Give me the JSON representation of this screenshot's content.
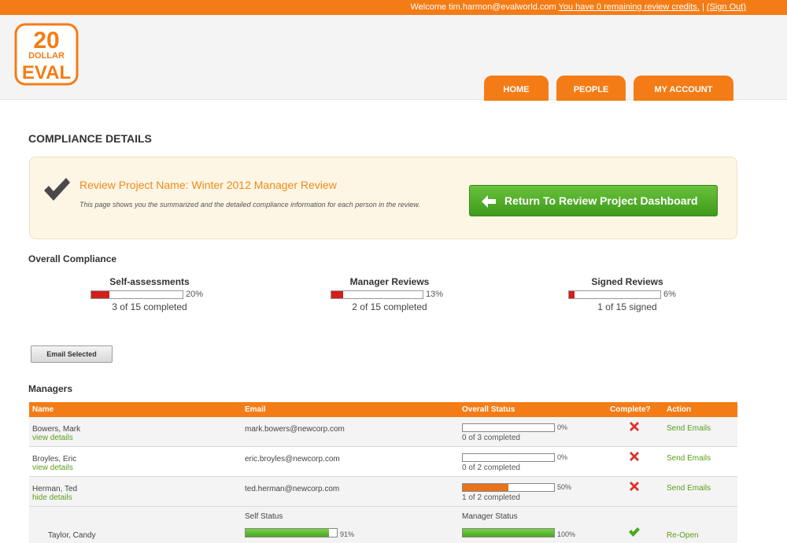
{
  "topbar": {
    "welcome_text": "Welcome tim.harmon@evalworld.com",
    "credits_link": "You have 0 remaining review credits.",
    "separator": "|",
    "sign_out": "(Sign Out)"
  },
  "logo": {
    "line1": "20",
    "line2": "DOLLAR",
    "line3": "EVAL"
  },
  "nav": {
    "home": "HOME",
    "people": "PEOPLE",
    "account": "MY ACCOUNT"
  },
  "page": {
    "title": "COMPLIANCE DETAILS"
  },
  "project": {
    "name": "Review Project Name: Winter 2012 Manager Review",
    "description": "This page shows you the summarized and the detailed compliance information for each person in the review.",
    "return_button": "Return To Review Project Dashboard"
  },
  "overall": {
    "title": "Overall Compliance",
    "stats": [
      {
        "title": "Self-assessments",
        "percent_text": "20%",
        "fill_fraction": 0.2,
        "summary": "3 of 15 completed"
      },
      {
        "title": "Manager Reviews",
        "percent_text": "13%",
        "fill_fraction": 0.13,
        "summary": "2 of 15 completed"
      },
      {
        "title": "Signed Reviews",
        "percent_text": "6%",
        "fill_fraction": 0.06,
        "summary": "1 of 15 signed"
      }
    ]
  },
  "email_selected_button": "Email Selected",
  "managers": {
    "title": "Managers",
    "headers": {
      "name": "Name",
      "email": "Email",
      "status": "Overall Status",
      "complete": "Complete?",
      "action": "Action"
    },
    "rows": [
      {
        "name": "Bowers, Mark",
        "details": "view details",
        "email": "mark.bowers@newcorp.com",
        "percent_text": "0%",
        "fill_fraction": 0,
        "status_text": "0 of 3 completed",
        "complete_icon": "x-icon",
        "action": "Send Emails"
      },
      {
        "name": "Broyles, Eric",
        "details": "view details",
        "email": "eric.broyles@newcorp.com",
        "percent_text": "0%",
        "fill_fraction": 0,
        "status_text": "0 of 2 completed",
        "complete_icon": "x-icon",
        "action": "Send Emails"
      },
      {
        "name": "Herman, Ted",
        "details": "hide details",
        "email": "ted.herman@newcorp.com",
        "percent_text": "50%",
        "fill_fraction": 0.5,
        "status_text": "1 of 2 completed",
        "complete_icon": "x-icon",
        "action": "Send Emails"
      }
    ],
    "detail": {
      "self_label": "Self Status",
      "manager_label": "Manager Status",
      "person": "Taylor, Candy",
      "self_percent_text": "91%",
      "self_fraction": 0.91,
      "manager_percent_text": "100%",
      "manager_fraction": 1.0,
      "complete_icon": "check-icon",
      "action": "Re-Open"
    }
  },
  "colors": {
    "brand_orange": "#f47c16",
    "link_green": "#5a9e1a",
    "button_green": "#4caa22",
    "progress_red": "#d0201c",
    "x_red": "#d9342b"
  }
}
